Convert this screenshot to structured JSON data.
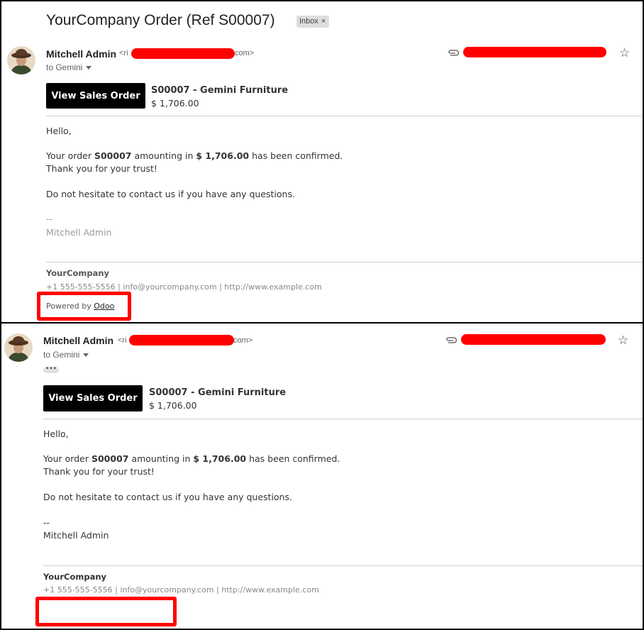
{
  "subject": "YourCompany Order (Ref S00007)",
  "inbox_label": "Inbox",
  "inbox_close": "×",
  "emails": [
    {
      "sender_name": "Mitchell Admin",
      "email_prefix": "<ri",
      "email_suffix": "com>",
      "to": "to Gemini",
      "button_label": "View Sales Order",
      "order_title": "S00007 - Gemini Furniture",
      "order_amount": "$ 1,706.00",
      "greeting": "Hello,",
      "line1_a": "Your order ",
      "order_ref": "S00007",
      "line1_b": " amounting in ",
      "amount_bold": "$ 1,706.00",
      "line1_c": " has been confirmed.",
      "line2": "Thank you for your trust!",
      "line3": "Do not hesitate to contact us if you have any questions.",
      "sig_dash": "--",
      "sig_name": "Mitchell Admin",
      "company": "YourCompany",
      "contact": "+1 555-555-5556 | info@yourcompany.com | http://www.example.com",
      "powered_by": "Powered by ",
      "powered_link": "Odoo",
      "star": "☆"
    },
    {
      "sender_name": "Mitchell Admin",
      "email_prefix": "<ri",
      "email_suffix": "com>",
      "to": "to Gemini",
      "dots": "•••",
      "button_label": "View Sales Order",
      "order_title": "S00007 - Gemini Furniture",
      "order_amount": "$ 1,706.00",
      "greeting": "Hello,",
      "line1_a": "Your order ",
      "order_ref": "S00007",
      "line1_b": " amounting in ",
      "amount_bold": "$ 1,706.00",
      "line1_c": " has been confirmed.",
      "line2": "Thank you for your trust!",
      "line3": "Do not hesitate to contact us if you have any questions.",
      "sig_dash": "--",
      "sig_name": "Mitchell Admin",
      "company": "YourCompany",
      "contact": "+1 555-555-5556 | info@yourcompany.com | http://www.example.com",
      "star": "☆"
    }
  ],
  "colors": {
    "redaction": "#ff0000",
    "button_bg": "#000000",
    "highlight": "#ff0000"
  },
  "icons": [
    "avatar-icon",
    "paperclip-icon",
    "star-icon",
    "caret-down-icon"
  ]
}
